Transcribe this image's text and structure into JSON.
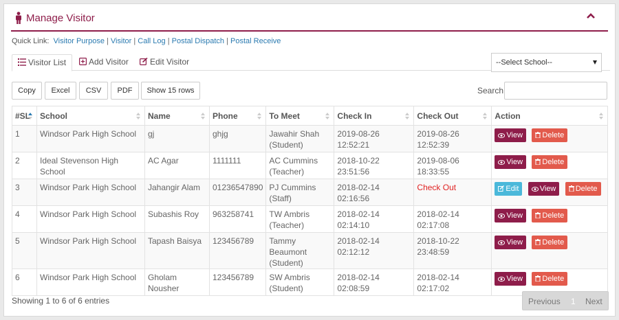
{
  "header": {
    "title": "Manage Visitor",
    "accent": "#8e1d4a"
  },
  "quick_links": {
    "label": "Quick Link:",
    "links": [
      "Visitor Purpose",
      "Visitor",
      "Call Log",
      "Postal Dispatch",
      "Postal Receive"
    ]
  },
  "tabs": [
    {
      "label": "Visitor List",
      "icon": "list-icon",
      "active": true
    },
    {
      "label": "Add Visitor",
      "icon": "plus-square-icon",
      "active": false
    },
    {
      "label": "Edit Visitor",
      "icon": "edit-icon",
      "active": false
    }
  ],
  "school_select": {
    "selected": "--Select School--"
  },
  "toolbar": {
    "copy": "Copy",
    "excel": "Excel",
    "csv": "CSV",
    "pdf": "PDF",
    "show_rows": "Show 15 rows"
  },
  "search": {
    "label": "Search:",
    "value": ""
  },
  "table": {
    "columns": [
      "#SL",
      "School",
      "Name",
      "Phone",
      "To Meet",
      "Check In",
      "Check Out",
      "Action"
    ],
    "rows": [
      {
        "sl": "1",
        "school": "Windsor Park High School",
        "name": "gj",
        "phone": "ghjg",
        "to_meet": "Jawahir Shah",
        "to_meet_role": "(Student)",
        "check_in": "2019-08-26 12:52:21",
        "check_out": "2019-08-26 12:52:39"
      },
      {
        "sl": "2",
        "school": "Ideal Stevenson High School",
        "name": "AC Agar",
        "phone": "1111111",
        "to_meet": "AC Cummins",
        "to_meet_role": "(Teacher)",
        "check_in": "2018-10-22 23:51:56",
        "check_out": "2019-08-06 18:33:55"
      },
      {
        "sl": "3",
        "school": "Windsor Park High School",
        "name": "Jahangir Alam",
        "phone": "01236547890",
        "to_meet": "PJ Cummins",
        "to_meet_role": "(Staff)",
        "check_in": "2018-02-14 02:16:56",
        "check_out": "Check Out"
      },
      {
        "sl": "4",
        "school": "Windsor Park High School",
        "name": "Subashis Roy",
        "phone": "963258741",
        "to_meet": "TW Ambris",
        "to_meet_role": "(Teacher)",
        "check_in": "2018-02-14 02:14:10",
        "check_out": "2018-02-14 02:17:08"
      },
      {
        "sl": "5",
        "school": "Windsor Park High School",
        "name": "Tapash Baisya",
        "phone": "123456789",
        "to_meet": "Tammy Beaumont",
        "to_meet_role": "(Student)",
        "check_in": "2018-02-14 02:12:12",
        "check_out": "2018-10-22 23:48:59"
      },
      {
        "sl": "6",
        "school": "Windsor Park High School",
        "name": "Gholam Nousher",
        "phone": "123456789",
        "to_meet": "SW Ambris",
        "to_meet_role": "(Student)",
        "check_in": "2018-02-14 02:08:59",
        "check_out": "2018-02-14 02:17:02"
      }
    ],
    "actions": {
      "edit": "Edit",
      "view": "View",
      "delete": "Delete"
    }
  },
  "footer": {
    "info": "Showing 1 to 6 of 6 entries",
    "pagination": {
      "previous": "Previous",
      "page": "1",
      "next": "Next"
    }
  },
  "colors": {
    "view": "#8e1d4a",
    "delete": "#e25a4c",
    "edit": "#4bb8da",
    "checkout_link": "#e02222",
    "link": "#2a7ab0"
  }
}
